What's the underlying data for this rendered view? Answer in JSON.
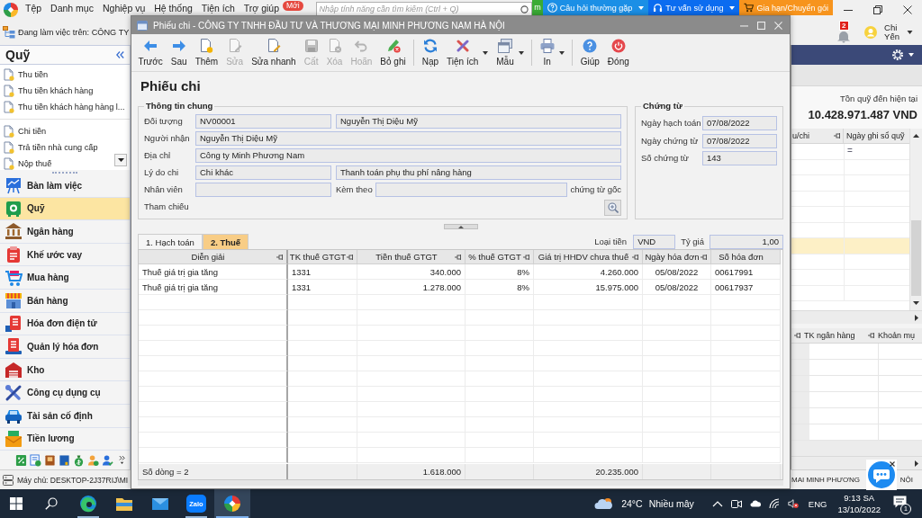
{
  "menubar": {
    "items": [
      "Tệp",
      "Danh mục",
      "Nghiệp vụ",
      "Hệ thống",
      "Tiện ích",
      "Trợ giúp"
    ],
    "new_badge": "Mới",
    "search": {
      "placeholder": "Nhập tính năng cần tìm kiếm (Ctrl + Q)"
    },
    "promo": "m",
    "links": [
      {
        "label": "Câu hỏi thường gặp",
        "kind": "help",
        "color": "#1b8fe6",
        "dropdown": true
      },
      {
        "label": "Tư vấn sử dụng",
        "kind": "support",
        "color": "#0b6cf0",
        "dropdown": true
      },
      {
        "label": "Gia hạn/Chuyển gói",
        "kind": "cart",
        "color": "#f7941d",
        "dropdown": false
      }
    ]
  },
  "workspace": {
    "label": "Đang làm việc trên: CÔNG TY"
  },
  "user": {
    "notifications": "2",
    "name": "Chi Yến"
  },
  "sidebar": {
    "title": "Quỹ",
    "task_groups": [
      {
        "items": [
          "Thu tiền",
          "Thu tiền khách hàng",
          "Thu tiền khách hàng hàng l..."
        ]
      },
      {
        "items": [
          "Chi tiền",
          "Trả tiền nhà cung cấp",
          "Nộp thuế"
        ]
      }
    ],
    "modules": [
      {
        "label": "Bàn làm việc",
        "kind": "desk",
        "selected": false
      },
      {
        "label": "Quỹ",
        "kind": "fund",
        "selected": true
      },
      {
        "label": "Ngân hàng",
        "kind": "bank",
        "selected": false
      },
      {
        "label": "Khế ước vay",
        "kind": "loan",
        "selected": false
      },
      {
        "label": "Mua hàng",
        "kind": "purchase",
        "selected": false
      },
      {
        "label": "Bán hàng",
        "kind": "sales",
        "selected": false
      },
      {
        "label": "Hóa đơn điện tử",
        "kind": "einvoice",
        "selected": false
      },
      {
        "label": "Quản lý hóa đơn",
        "kind": "invoices",
        "selected": false
      },
      {
        "label": "Kho",
        "kind": "warehouse",
        "selected": false
      },
      {
        "label": "Công cụ dụng cụ",
        "kind": "tools",
        "selected": false
      },
      {
        "label": "Tài sản cố định",
        "kind": "assets",
        "selected": false
      },
      {
        "label": "Tiền lương",
        "kind": "payroll",
        "selected": false
      }
    ]
  },
  "cash_panel": {
    "balance_label": "Tồn quỹ đến hiện tại",
    "balance": "10.428.971.487 VND",
    "receipts_table": {
      "columns": [
        "u/chi",
        "Ngày ghi sổ quỹ"
      ],
      "filter_operator": "=",
      "rows": [
        {
          "selected": false
        },
        {
          "selected": false
        },
        {
          "selected": false
        },
        {
          "selected": false
        },
        {
          "selected": false
        },
        {
          "selected": true
        },
        {
          "selected": false
        },
        {
          "selected": false
        },
        {
          "selected": false
        }
      ]
    },
    "bank_table": {
      "columns": [
        "TK ngân hàng",
        "Khoản mụ"
      ]
    }
  },
  "status_bar": {
    "server": "Máy chủ: DESKTOP-2J37RIJ\\MI",
    "company_left": "MAI MINH PHƯƠNG",
    "company_right": "NỘI"
  },
  "dialog": {
    "title": "Phiếu chi - CÔNG TY TNHH ĐẦU TƯ VÀ THƯƠNG MẠI MINH PHƯƠNG NAM HÀ NỘI",
    "toolbar": [
      {
        "buttons": [
          {
            "label": "Trước",
            "kind": "prev",
            "disabled": false,
            "dropdown": false
          },
          {
            "label": "Sau",
            "kind": "next",
            "disabled": false,
            "dropdown": false
          },
          {
            "label": "Thêm",
            "kind": "add",
            "disabled": false,
            "dropdown": false
          },
          {
            "label": "Sửa",
            "kind": "edit",
            "disabled": true,
            "dropdown": false
          },
          {
            "label": "Sửa nhanh",
            "kind": "quick_edit",
            "disabled": false,
            "dropdown": false
          },
          {
            "label": "Cất",
            "kind": "save",
            "disabled": true,
            "dropdown": false
          },
          {
            "label": "Xóa",
            "kind": "delete",
            "disabled": true,
            "dropdown": false
          },
          {
            "label": "Hoãn",
            "kind": "defer",
            "disabled": true,
            "dropdown": false
          },
          {
            "label": "Bỏ ghi",
            "kind": "unpost",
            "disabled": false,
            "dropdown": false
          }
        ]
      },
      {
        "buttons": [
          {
            "label": "Nạp",
            "kind": "reload",
            "disabled": false,
            "dropdown": false
          },
          {
            "label": "Tiện ích",
            "kind": "utilities",
            "disabled": false,
            "dropdown": true
          },
          {
            "label": "Mẫu",
            "kind": "template",
            "disabled": false,
            "dropdown": true
          }
        ]
      },
      {
        "buttons": [
          {
            "label": "In",
            "kind": "print",
            "disabled": false,
            "dropdown": true
          }
        ]
      },
      {
        "buttons": [
          {
            "label": "Giúp",
            "kind": "help",
            "disabled": false,
            "dropdown": false
          },
          {
            "label": "Đóng",
            "kind": "close",
            "disabled": false,
            "dropdown": false
          }
        ]
      }
    ],
    "heading": "Phiếu chi",
    "general": {
      "legend": "Thông tin chung",
      "object": {
        "label": "Đối tượng",
        "code": "NV00001",
        "name": "Nguyễn Thị Diệu Mỹ"
      },
      "recipient": {
        "label": "Người nhận",
        "value": "Nguyễn Thị Diệu Mỹ"
      },
      "address": {
        "label": "Địa chỉ",
        "value": "Công ty Minh Phương Nam"
      },
      "reason": {
        "label": "Lý do chi",
        "code": "Chi khác",
        "description": "Thanh toán phụ thu phí nâng hàng"
      },
      "employee": {
        "label": "Nhân viên"
      },
      "attachments": {
        "label": "Kèm theo",
        "suffix": "chứng từ gốc"
      },
      "reference": {
        "label": "Tham chiếu"
      }
    },
    "voucher": {
      "legend": "Chứng từ",
      "fields": [
        {
          "label": "Ngày hạch toán",
          "value": "07/08/2022"
        },
        {
          "label": "Ngày chứng từ",
          "value": "07/08/2022"
        },
        {
          "label": "Số chứng từ",
          "value": "143"
        }
      ]
    },
    "tabs": [
      {
        "label": "1. Hạch toán",
        "selected": false
      },
      {
        "label": "2. Thuế",
        "selected": true
      }
    ],
    "currency": {
      "label": "Loại tiền",
      "value": "VND"
    },
    "exchange_rate": {
      "label": "Tỷ giá",
      "value": "1,00"
    },
    "table": {
      "columns": [
        {
          "label": "Diễn giải",
          "kind": "text"
        },
        {
          "label": "TK thuế GTGT",
          "kind": "code"
        },
        {
          "label": "Tiền thuế GTGT",
          "kind": "number",
          "total": "1.618.000"
        },
        {
          "label": "% thuế GTGT",
          "kind": "number"
        },
        {
          "label": "Giá trị HHDV chưa thuế",
          "kind": "number",
          "total": "20.235.000"
        },
        {
          "label": "Ngày hóa đơn",
          "kind": "date"
        },
        {
          "label": "Số hóa đơn",
          "kind": "code"
        }
      ],
      "rows": [
        [
          "Thuế giá trị gia tăng",
          "1331",
          "340.000",
          "8%",
          "4.260.000",
          "05/08/2022",
          "00617991"
        ],
        [
          "Thuế giá trị gia tăng",
          "1331",
          "1.278.000",
          "8%",
          "15.975.000",
          "05/08/2022",
          "00617937"
        ]
      ],
      "row_count": "Số dòng = 2"
    }
  },
  "taskbar": {
    "apps": [
      {
        "kind": "browser",
        "running": true,
        "selected": false
      },
      {
        "kind": "folder",
        "running": false,
        "selected": false
      },
      {
        "kind": "mail",
        "running": false,
        "selected": false
      },
      {
        "kind": "chat",
        "label": "Zalo",
        "running": true,
        "selected": false
      },
      {
        "kind": "accounting",
        "running": true,
        "selected": true
      }
    ],
    "weather": {
      "temperature": "24°C",
      "condition": "Nhiều mây"
    },
    "language": "ENG",
    "time": "9:13 SA",
    "date": "13/10/2022",
    "notifications": "1"
  }
}
